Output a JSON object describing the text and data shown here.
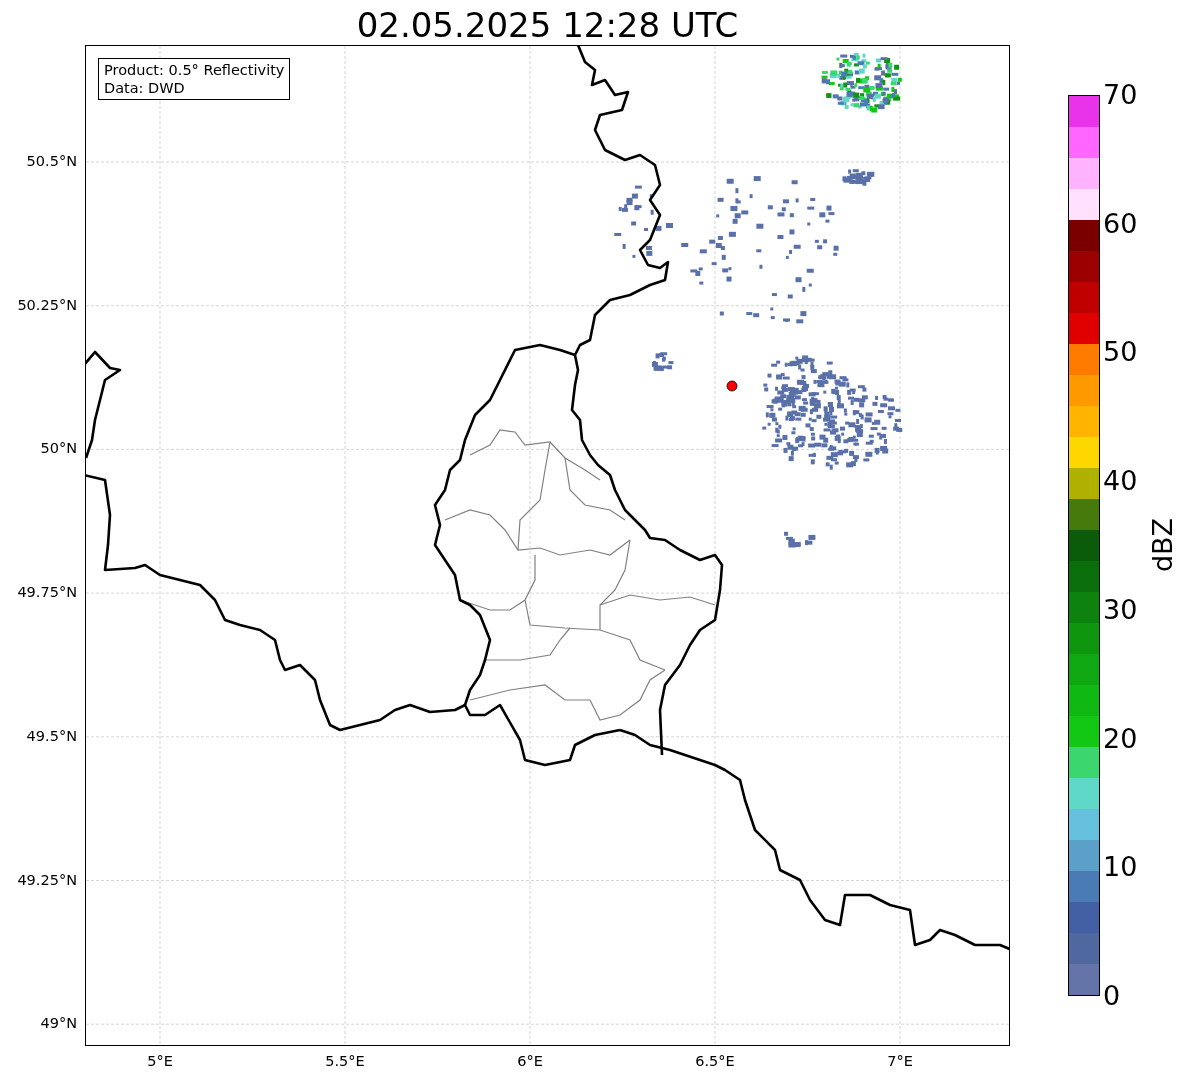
{
  "title": "02.05.2025 12:28 UTC",
  "info_box": [
    "Product: 0.5° Reflectivity",
    "Data: DWD"
  ],
  "map": {
    "x_ticks": [
      "5°E",
      "5.5°E",
      "6°E",
      "6.5°E",
      "7°E"
    ],
    "y_ticks": [
      "50.5°N",
      "50.25°N",
      "50°N",
      "49.75°N",
      "49.5°N",
      "49.25°N",
      "49°N"
    ]
  },
  "colorbar": {
    "label": "dBZ",
    "ticks": [
      "70",
      "60",
      "50",
      "40",
      "30",
      "20",
      "10",
      "0"
    ],
    "bins": [
      {
        "color": "#e933ea"
      },
      {
        "color": "#ff66ff"
      },
      {
        "color": "#ffb3ff"
      },
      {
        "color": "#ffe0ff"
      },
      {
        "color": "#7a0000"
      },
      {
        "color": "#9c0000"
      },
      {
        "color": "#c00000"
      },
      {
        "color": "#e00000"
      },
      {
        "color": "#ff7b00"
      },
      {
        "color": "#ff9900"
      },
      {
        "color": "#ffb400"
      },
      {
        "color": "#ffd700"
      },
      {
        "color": "#b0b000"
      },
      {
        "color": "#467a0a"
      },
      {
        "color": "#0a5c0a"
      },
      {
        "color": "#0a6e0a"
      },
      {
        "color": "#0e820e"
      },
      {
        "color": "#0e960e"
      },
      {
        "color": "#10a812"
      },
      {
        "color": "#10b814"
      },
      {
        "color": "#12c814"
      },
      {
        "color": "#3cd66e"
      },
      {
        "color": "#60d8c8"
      },
      {
        "color": "#64c0dc"
      },
      {
        "color": "#5aa0c8"
      },
      {
        "color": "#4a7bb4"
      },
      {
        "color": "#4460a4"
      },
      {
        "color": "#5068a0"
      },
      {
        "color": "#6474a8"
      }
    ]
  }
}
